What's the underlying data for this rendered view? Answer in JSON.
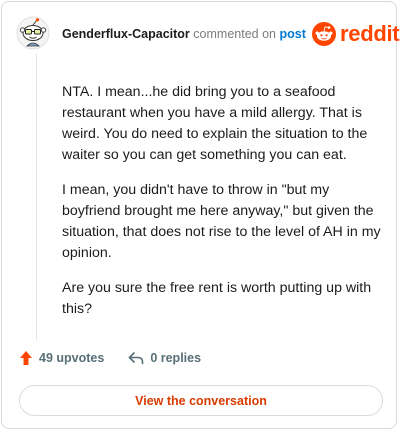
{
  "header": {
    "username": "Genderflux-Capacitor",
    "action_text": "commented on",
    "post_link": "post",
    "brand": "reddit"
  },
  "comment": {
    "paragraphs": [
      "NTA. I mean...he did bring you to a seafood restaurant when you have a mild allergy. That is weird. You do need to explain the situation to the waiter so you can get something you can eat.",
      "I mean, you didn't have to throw in \"but my boyfriend brought me here anyway,\" but given the situation, that does not rise to the level of AH in my opinion.",
      "Are you sure the free rent is worth putting up with this?"
    ]
  },
  "actions": {
    "upvotes": "49 upvotes",
    "replies": "0 replies"
  },
  "cta": {
    "label": "View the conversation"
  },
  "colors": {
    "brand": "#ff4500",
    "link": "#0079d3",
    "cta": "#d93a00",
    "upvote_icon": "#ff4500"
  },
  "icons": {
    "avatar": "snoo-avatar-icon",
    "brand": "reddit-logo-icon",
    "upvote": "upvote-arrow-icon",
    "reply": "reply-arrow-icon"
  }
}
